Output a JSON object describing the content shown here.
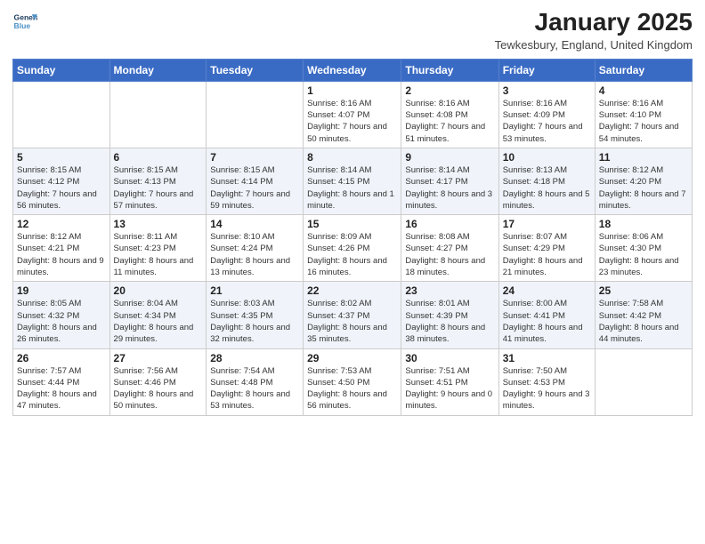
{
  "header": {
    "logo_line1": "General",
    "logo_line2": "Blue",
    "month": "January 2025",
    "location": "Tewkesbury, England, United Kingdom"
  },
  "weekdays": [
    "Sunday",
    "Monday",
    "Tuesday",
    "Wednesday",
    "Thursday",
    "Friday",
    "Saturday"
  ],
  "weeks": [
    [
      {
        "day": "",
        "info": ""
      },
      {
        "day": "",
        "info": ""
      },
      {
        "day": "",
        "info": ""
      },
      {
        "day": "1",
        "info": "Sunrise: 8:16 AM\nSunset: 4:07 PM\nDaylight: 7 hours\nand 50 minutes."
      },
      {
        "day": "2",
        "info": "Sunrise: 8:16 AM\nSunset: 4:08 PM\nDaylight: 7 hours\nand 51 minutes."
      },
      {
        "day": "3",
        "info": "Sunrise: 8:16 AM\nSunset: 4:09 PM\nDaylight: 7 hours\nand 53 minutes."
      },
      {
        "day": "4",
        "info": "Sunrise: 8:16 AM\nSunset: 4:10 PM\nDaylight: 7 hours\nand 54 minutes."
      }
    ],
    [
      {
        "day": "5",
        "info": "Sunrise: 8:15 AM\nSunset: 4:12 PM\nDaylight: 7 hours\nand 56 minutes."
      },
      {
        "day": "6",
        "info": "Sunrise: 8:15 AM\nSunset: 4:13 PM\nDaylight: 7 hours\nand 57 minutes."
      },
      {
        "day": "7",
        "info": "Sunrise: 8:15 AM\nSunset: 4:14 PM\nDaylight: 7 hours\nand 59 minutes."
      },
      {
        "day": "8",
        "info": "Sunrise: 8:14 AM\nSunset: 4:15 PM\nDaylight: 8 hours\nand 1 minute."
      },
      {
        "day": "9",
        "info": "Sunrise: 8:14 AM\nSunset: 4:17 PM\nDaylight: 8 hours\nand 3 minutes."
      },
      {
        "day": "10",
        "info": "Sunrise: 8:13 AM\nSunset: 4:18 PM\nDaylight: 8 hours\nand 5 minutes."
      },
      {
        "day": "11",
        "info": "Sunrise: 8:12 AM\nSunset: 4:20 PM\nDaylight: 8 hours\nand 7 minutes."
      }
    ],
    [
      {
        "day": "12",
        "info": "Sunrise: 8:12 AM\nSunset: 4:21 PM\nDaylight: 8 hours\nand 9 minutes."
      },
      {
        "day": "13",
        "info": "Sunrise: 8:11 AM\nSunset: 4:23 PM\nDaylight: 8 hours\nand 11 minutes."
      },
      {
        "day": "14",
        "info": "Sunrise: 8:10 AM\nSunset: 4:24 PM\nDaylight: 8 hours\nand 13 minutes."
      },
      {
        "day": "15",
        "info": "Sunrise: 8:09 AM\nSunset: 4:26 PM\nDaylight: 8 hours\nand 16 minutes."
      },
      {
        "day": "16",
        "info": "Sunrise: 8:08 AM\nSunset: 4:27 PM\nDaylight: 8 hours\nand 18 minutes."
      },
      {
        "day": "17",
        "info": "Sunrise: 8:07 AM\nSunset: 4:29 PM\nDaylight: 8 hours\nand 21 minutes."
      },
      {
        "day": "18",
        "info": "Sunrise: 8:06 AM\nSunset: 4:30 PM\nDaylight: 8 hours\nand 23 minutes."
      }
    ],
    [
      {
        "day": "19",
        "info": "Sunrise: 8:05 AM\nSunset: 4:32 PM\nDaylight: 8 hours\nand 26 minutes."
      },
      {
        "day": "20",
        "info": "Sunrise: 8:04 AM\nSunset: 4:34 PM\nDaylight: 8 hours\nand 29 minutes."
      },
      {
        "day": "21",
        "info": "Sunrise: 8:03 AM\nSunset: 4:35 PM\nDaylight: 8 hours\nand 32 minutes."
      },
      {
        "day": "22",
        "info": "Sunrise: 8:02 AM\nSunset: 4:37 PM\nDaylight: 8 hours\nand 35 minutes."
      },
      {
        "day": "23",
        "info": "Sunrise: 8:01 AM\nSunset: 4:39 PM\nDaylight: 8 hours\nand 38 minutes."
      },
      {
        "day": "24",
        "info": "Sunrise: 8:00 AM\nSunset: 4:41 PM\nDaylight: 8 hours\nand 41 minutes."
      },
      {
        "day": "25",
        "info": "Sunrise: 7:58 AM\nSunset: 4:42 PM\nDaylight: 8 hours\nand 44 minutes."
      }
    ],
    [
      {
        "day": "26",
        "info": "Sunrise: 7:57 AM\nSunset: 4:44 PM\nDaylight: 8 hours\nand 47 minutes."
      },
      {
        "day": "27",
        "info": "Sunrise: 7:56 AM\nSunset: 4:46 PM\nDaylight: 8 hours\nand 50 minutes."
      },
      {
        "day": "28",
        "info": "Sunrise: 7:54 AM\nSunset: 4:48 PM\nDaylight: 8 hours\nand 53 minutes."
      },
      {
        "day": "29",
        "info": "Sunrise: 7:53 AM\nSunset: 4:50 PM\nDaylight: 8 hours\nand 56 minutes."
      },
      {
        "day": "30",
        "info": "Sunrise: 7:51 AM\nSunset: 4:51 PM\nDaylight: 9 hours\nand 0 minutes."
      },
      {
        "day": "31",
        "info": "Sunrise: 7:50 AM\nSunset: 4:53 PM\nDaylight: 9 hours\nand 3 minutes."
      },
      {
        "day": "",
        "info": ""
      }
    ]
  ]
}
